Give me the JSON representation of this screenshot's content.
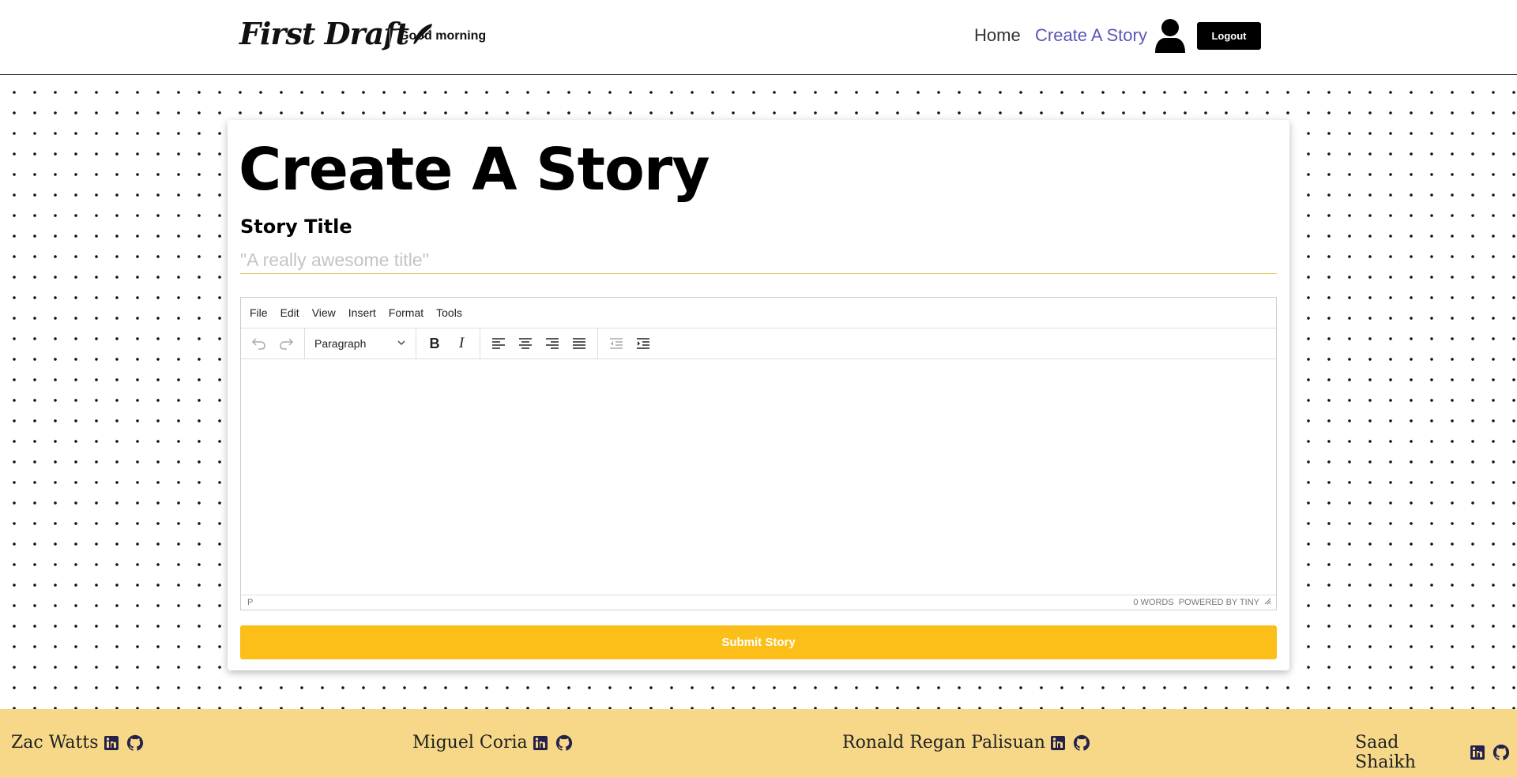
{
  "header": {
    "logo_text": "First Draft",
    "greeting": "Good morning",
    "nav": {
      "home": "Home",
      "create": "Create A Story"
    },
    "logout_label": "Logout"
  },
  "main": {
    "page_title": "Create A Story",
    "story_title_label": "Story Title",
    "story_title_placeholder": "\"A really awesome title\"",
    "story_title_value": ""
  },
  "editor": {
    "menu": [
      "File",
      "Edit",
      "View",
      "Insert",
      "Format",
      "Tools"
    ],
    "block_format": "Paragraph",
    "toolbar_icons": [
      "undo-icon",
      "redo-icon",
      "bold-icon",
      "italic-icon",
      "align-left-icon",
      "align-center-icon",
      "align-right-icon",
      "align-justify-icon",
      "outdent-icon",
      "indent-icon"
    ],
    "status_path": "P",
    "word_count": "0 WORDS",
    "powered_by": "POWERED BY TINY"
  },
  "submit_label": "Submit Story",
  "footer": {
    "members": [
      {
        "name": "Zac Watts"
      },
      {
        "name": "Miguel Coria"
      },
      {
        "name": "Ronald Regan Palisuan"
      },
      {
        "name": "Saad Shaikh"
      }
    ]
  },
  "colors": {
    "accent": "#fcbe19",
    "footer_bg": "#f6d888",
    "nav_active": "#5a57b5",
    "icon_dark": "#24214d"
  }
}
